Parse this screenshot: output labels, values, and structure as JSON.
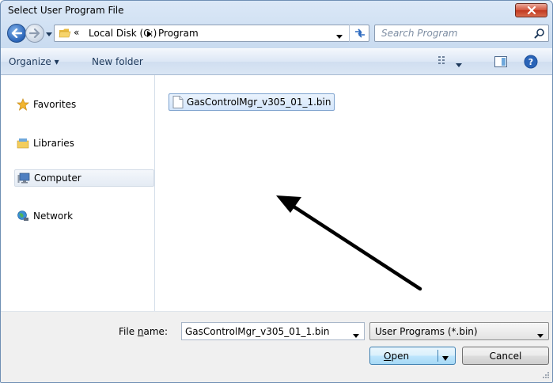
{
  "window": {
    "title": "Select User Program File"
  },
  "address_bar": {
    "overflow_chevron": "«",
    "segments": [
      "Local Disk (C:)",
      "Program"
    ],
    "separator": "▸"
  },
  "search": {
    "placeholder": "Search Program"
  },
  "toolbar": {
    "organize_label": "Organize ▾",
    "new_folder_label": "New folder"
  },
  "navigation": {
    "items": [
      {
        "label": "Favorites",
        "icon": "star-icon"
      },
      {
        "label": "Libraries",
        "icon": "libraries-icon"
      },
      {
        "label": "Computer",
        "icon": "computer-icon",
        "selected": true
      },
      {
        "label": "Network",
        "icon": "network-icon"
      }
    ]
  },
  "files": [
    {
      "name": "GasControlMgr_v305_01_1.bin",
      "icon": "document-icon",
      "selected": true
    }
  ],
  "footer": {
    "file_name_label_pre": "File ",
    "file_name_label_accel": "n",
    "file_name_label_post": "ame:",
    "file_name_value": "GasControlMgr_v305_01_1.bin",
    "file_type_value": "User Programs (*.bin)",
    "open_label": "Open",
    "cancel_label": "Cancel"
  },
  "colors": {
    "selection_fill": "#d4e6fb",
    "selection_border": "#7da2ce",
    "close_button": "#c7422a",
    "annotation_arrow": "#000000"
  }
}
